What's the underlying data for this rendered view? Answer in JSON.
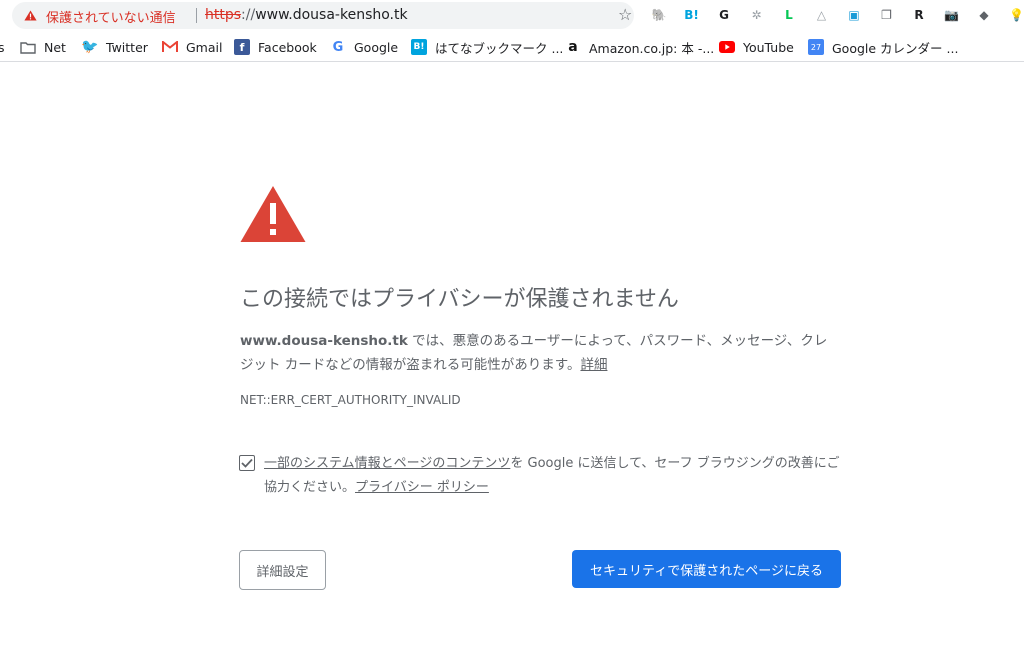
{
  "omnibox": {
    "security_label": "保護されていない通信",
    "url_scheme": "https",
    "url_separator": "://",
    "url_host": "www.dousa-kensho.tk"
  },
  "extensions": [
    {
      "name": "evernote-icon",
      "glyph": "🐘",
      "color": "#2dbe60"
    },
    {
      "name": "hatena-bookmark-ext-icon",
      "glyph": "B!",
      "color": "#00a4de"
    },
    {
      "name": "grammarly-icon",
      "glyph": "G",
      "color": "#202124"
    },
    {
      "name": "settings-ext-icon",
      "glyph": "✲",
      "color": "#9aa0a6"
    },
    {
      "name": "line-icon",
      "glyph": "L",
      "color": "#06c755"
    },
    {
      "name": "drive-icon",
      "glyph": "△",
      "color": "#9aa0a6"
    },
    {
      "name": "window-ext-icon",
      "glyph": "▣",
      "color": "#1a9bd7"
    },
    {
      "name": "copy-icon",
      "glyph": "❐",
      "color": "#5f6368"
    },
    {
      "name": "rakuten-icon",
      "glyph": "R",
      "color": "#202124"
    },
    {
      "name": "camera-icon",
      "glyph": "📷",
      "color": "#5f6368"
    },
    {
      "name": "layers-icon",
      "glyph": "◆",
      "color": "#5f6368"
    },
    {
      "name": "bulb-icon",
      "glyph": "💡",
      "color": "#5f6368"
    }
  ],
  "bookmarks": [
    {
      "label": "s",
      "icon": ""
    },
    {
      "label": "Net",
      "icon": "folder-icon"
    },
    {
      "label": "Twitter",
      "icon": "twitter-icon"
    },
    {
      "label": "Gmail",
      "icon": "gmail-icon"
    },
    {
      "label": "Facebook",
      "icon": "facebook-icon"
    },
    {
      "label": "Google",
      "icon": "google-icon"
    },
    {
      "label": "はてなブックマーク ...",
      "icon": "hatena-icon"
    },
    {
      "label": "Amazon.co.jp: 本 -...",
      "icon": "amazon-icon"
    },
    {
      "label": "YouTube",
      "icon": "youtube-icon"
    },
    {
      "label": "Google カレンダー ...",
      "icon": "calendar-icon"
    }
  ],
  "calendar_day": "27",
  "interstitial": {
    "heading": "この接続ではプライバシーが保護されません",
    "host": "www.dousa-kensho.tk",
    "explanation": " では、悪意のあるユーザーによって、パスワード、メッセージ、クレジット カードなどの情報が盗まれる可能性があります。",
    "details_link": "詳細",
    "error_code": "NET::ERR_CERT_AUTHORITY_INVALID",
    "optin_link": "一部のシステム情報とページのコンテンツ",
    "optin_text": "を Google に送信して、セーフ ブラウジングの改善にご協力ください。",
    "privacy_link": "プライバシー ポリシー",
    "checkbox_checked": true,
    "advanced_button": "詳細設定",
    "back_button": "セキュリティで保護されたページに戻る"
  },
  "colors": {
    "danger": "#d93025",
    "primary": "#1a73e8",
    "text_secondary": "#5f6368"
  }
}
